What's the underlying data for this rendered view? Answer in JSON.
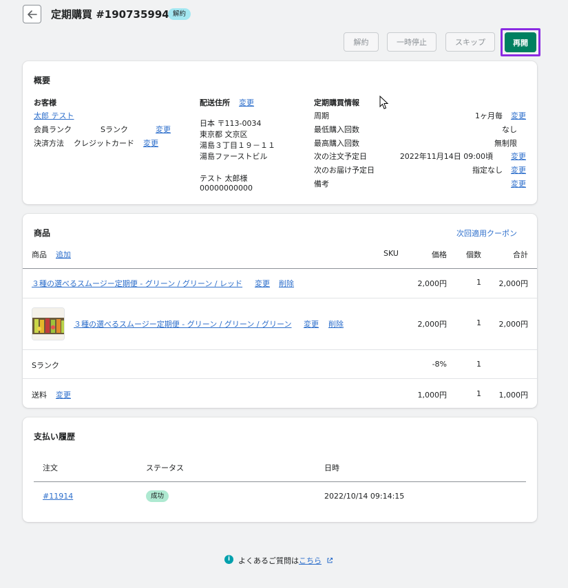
{
  "header": {
    "title": "定期購買 #1907359949",
    "status": "解約"
  },
  "actions": {
    "cancel": "解約",
    "pause": "一時停止",
    "skip": "スキップ",
    "resume": "再開"
  },
  "overview": {
    "title": "概要",
    "customer": {
      "heading": "お客様",
      "name": "太郎 テスト",
      "rank_label": "会員ランク",
      "rank_value": "Sランク",
      "rank_change": "変更",
      "payment_label": "決済方法",
      "payment_value": "クレジットカード",
      "payment_change": "変更"
    },
    "shipping": {
      "heading": "配送住所",
      "change": "変更",
      "line1": "日本 〒113-0034",
      "line2": "東京都 文京区",
      "line3": "湯島３丁目１９－１１",
      "line4": "湯島ファーストビル",
      "name": "テスト 太郎様",
      "phone": "00000000000"
    },
    "subscription": {
      "heading": "定期購買情報",
      "rows": [
        {
          "label": "周期",
          "value": "1ヶ月毎",
          "link": "変更"
        },
        {
          "label": "最低購入回数",
          "value": "なし",
          "link": ""
        },
        {
          "label": "最高購入回数",
          "value": "無制限",
          "link": ""
        },
        {
          "label": "次の注文予定日",
          "value": "2022年11月14日 09:00頃",
          "link": "変更"
        },
        {
          "label": "次のお届け予定日",
          "value": "指定なし",
          "link": "変更"
        },
        {
          "label": "備考",
          "value": "",
          "link": "変更"
        }
      ]
    }
  },
  "products": {
    "title": "商品",
    "coupon_link": "次回適用クーポン",
    "columns": {
      "product": "商品",
      "add": "追加",
      "sku": "SKU",
      "price": "価格",
      "qty": "個数",
      "total": "合計"
    },
    "rows": [
      {
        "name": "３種の選べるスムージー定期便 - グリーン / グリーン / レッド",
        "change": "変更",
        "delete": "削除",
        "price": "2,000円",
        "qty": "1",
        "total": "2,000円"
      },
      {
        "name": "３種の選べるスムージー定期便 - グリーン / グリーン / グリーン",
        "change": "変更",
        "delete": "削除",
        "price": "2,000円",
        "qty": "1",
        "total": "2,000円"
      }
    ],
    "discount": {
      "label": "Sランク",
      "price": "-8%",
      "qty": "1"
    },
    "shipping": {
      "label": "送料",
      "change": "変更",
      "price": "1,000円",
      "qty": "1",
      "total": "1,000円"
    }
  },
  "payments": {
    "title": "支払い履歴",
    "columns": {
      "order": "注文",
      "status": "ステータス",
      "date": "日時"
    },
    "rows": [
      {
        "order": "#11914",
        "status": "成功",
        "date": "2022/10/14 09:14:15"
      }
    ]
  },
  "footer": {
    "text": "よくあるご質問は",
    "link": "こちら"
  }
}
